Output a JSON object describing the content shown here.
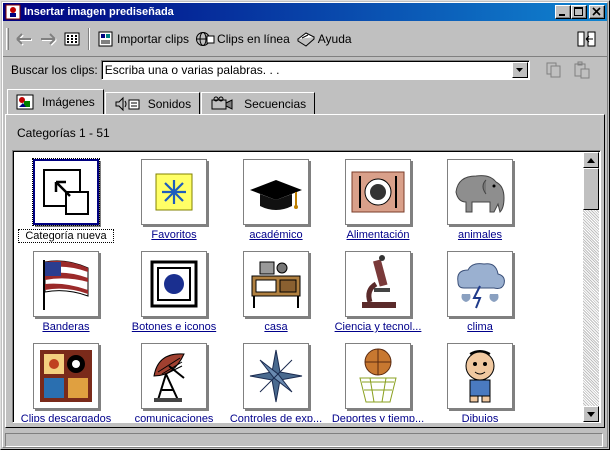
{
  "window": {
    "title": "Insertar imagen prediseñada"
  },
  "toolbar": {
    "import_label": "Importar clips",
    "online_label": "Clips en línea",
    "help_label": "Ayuda"
  },
  "search": {
    "label": "Buscar los clips:",
    "value": "Escriba una o varias palabras. . ."
  },
  "tabs": [
    {
      "label": "Imágenes"
    },
    {
      "label": "Sonidos"
    },
    {
      "label": "Secuencias"
    }
  ],
  "categories_header": "Categorías 1 - 51",
  "categories": [
    {
      "label": "Categoría nueva",
      "icon": "new-category-icon"
    },
    {
      "label": "Favoritos",
      "icon": "star-icon"
    },
    {
      "label": "académico",
      "icon": "graduation-cap-icon"
    },
    {
      "label": "Alimentación",
      "icon": "dinner-plate-icon"
    },
    {
      "label": "animales",
      "icon": "elephant-icon"
    },
    {
      "label": "Banderas",
      "icon": "flag-icon"
    },
    {
      "label": "Botones e iconos",
      "icon": "button-icon"
    },
    {
      "label": "casa",
      "icon": "kitchen-icon"
    },
    {
      "label": "Ciencia y tecnol...",
      "icon": "microscope-icon"
    },
    {
      "label": "clima",
      "icon": "storm-cloud-icon"
    },
    {
      "label": "Clips descargados",
      "icon": "photo-collage-icon"
    },
    {
      "label": "comunicaciones",
      "icon": "satellite-dish-icon"
    },
    {
      "label": "Controles de exp...",
      "icon": "compass-star-icon"
    },
    {
      "label": "Deportes y tiemp...",
      "icon": "basketball-icon"
    },
    {
      "label": "Dibujos",
      "icon": "cartoon-baby-icon"
    }
  ],
  "colors": {
    "title_start": "#000080",
    "title_end": "#1084d0",
    "link": "#00008b"
  }
}
